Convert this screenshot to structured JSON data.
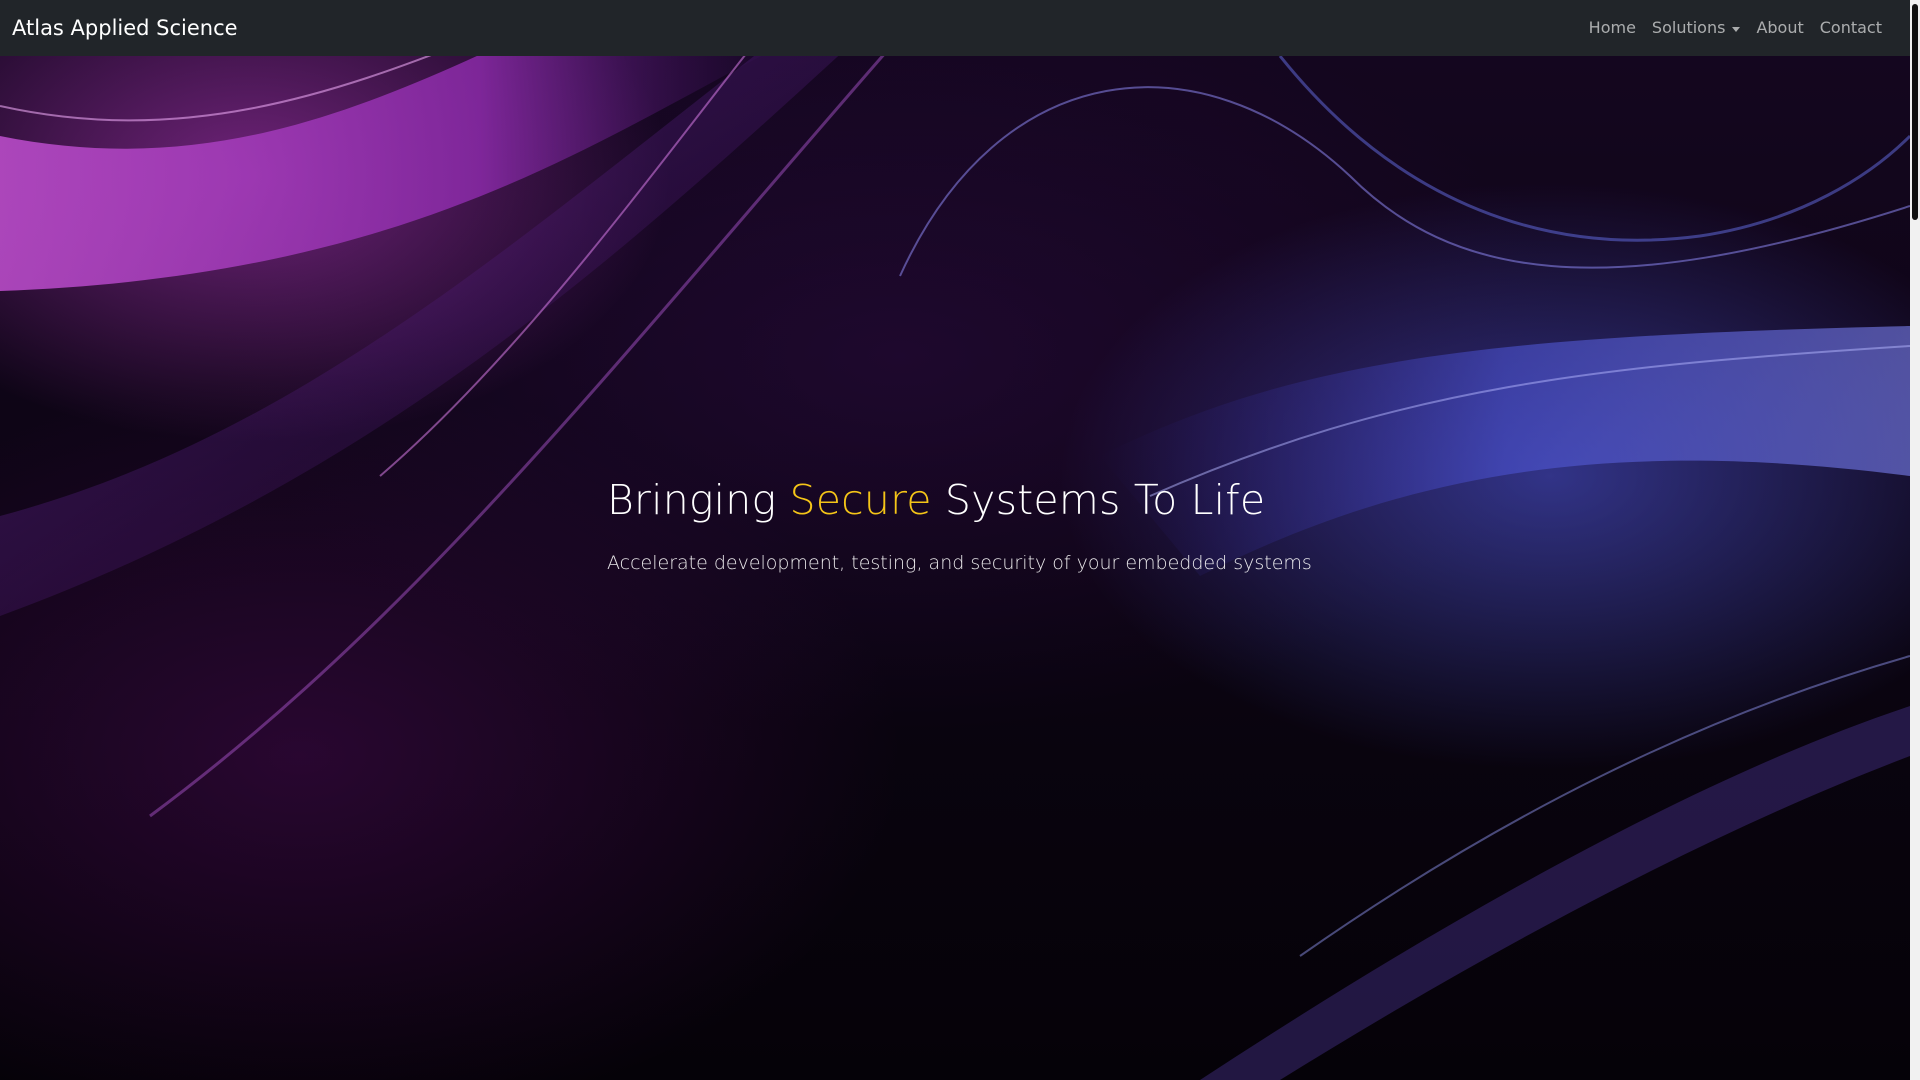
{
  "navbar": {
    "brand": "Atlas Applied Science",
    "items": [
      {
        "label": "Home"
      },
      {
        "label": "Solutions"
      },
      {
        "label": "About"
      },
      {
        "label": "Contact"
      }
    ]
  },
  "hero": {
    "headline_before": "Bringing ",
    "headline_accent": "Secure",
    "headline_after": " Systems To Life",
    "subheadline": "Accelerate development, testing, and security of your embedded systems",
    "accent_color": "#f5c518"
  },
  "colors": {
    "navbar_bg": "#212529",
    "hero_purple": "#b13fc4",
    "hero_blue": "#5a63e0"
  }
}
